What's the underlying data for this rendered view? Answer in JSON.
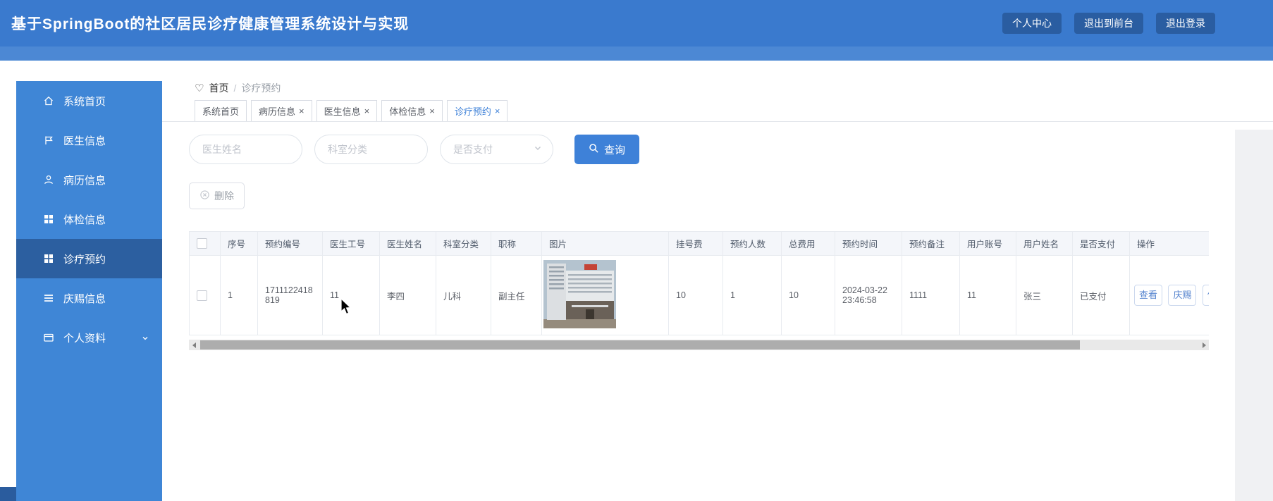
{
  "header": {
    "title": "基于SpringBoot的社区居民诊疗健康管理系统设计与实现",
    "actions": [
      {
        "label": "个人中心"
      },
      {
        "label": "退出到前台"
      },
      {
        "label": "退出登录"
      }
    ]
  },
  "sidebar": {
    "items": [
      {
        "label": "系统首页",
        "icon": "home-icon",
        "active": false
      },
      {
        "label": "医生信息",
        "icon": "flag-icon",
        "active": false
      },
      {
        "label": "病历信息",
        "icon": "user-icon",
        "active": false
      },
      {
        "label": "体检信息",
        "icon": "grid-icon",
        "active": false
      },
      {
        "label": "诊疗预约",
        "icon": "grid-icon",
        "active": true
      },
      {
        "label": "庆赐信息",
        "icon": "list-icon",
        "active": false
      },
      {
        "label": "个人资料",
        "icon": "folder-icon",
        "active": false,
        "has_submenu": true
      }
    ]
  },
  "breadcrumb": {
    "home": "首页",
    "current": "诊疗预约"
  },
  "tabs": [
    {
      "label": "系统首页",
      "closable": false,
      "active": false
    },
    {
      "label": "病历信息",
      "closable": true,
      "active": false
    },
    {
      "label": "医生信息",
      "closable": true,
      "active": false
    },
    {
      "label": "体检信息",
      "closable": true,
      "active": false
    },
    {
      "label": "诊疗预约",
      "closable": true,
      "active": true
    }
  ],
  "filters": {
    "doctor_name_placeholder": "医生姓名",
    "department_placeholder": "科室分类",
    "payment_placeholder": "是否支付",
    "search_label": "查询"
  },
  "toolbar": {
    "delete_label": "删除"
  },
  "table": {
    "columns": [
      "序号",
      "预约编号",
      "医生工号",
      "医生姓名",
      "科室分类",
      "职称",
      "图片",
      "挂号费",
      "预约人数",
      "总费用",
      "预约时间",
      "预约备注",
      "用户账号",
      "用户姓名",
      "是否支付",
      "操作"
    ],
    "rows": [
      {
        "seq": "1",
        "appointment_no": "1711122418819",
        "doctor_no": "11",
        "doctor_name": "李四",
        "department": "儿科",
        "job_title": "副主任",
        "image": "hospital-photo",
        "registration_fee": "10",
        "appointment_count": "1",
        "total_fee": "10",
        "appointment_time": "2024-03-22 23:46:58",
        "remark": "1111",
        "user_account": "11",
        "user_name": "张三",
        "payment_status": "已支付",
        "actions": {
          "view": "查看",
          "qingci": "庆赐",
          "edit": "修改"
        }
      }
    ]
  },
  "icons": {
    "heart": "♡",
    "close": "×",
    "breadcrumb_separator": "/"
  },
  "colors": {
    "header_bg": "#3a7ace",
    "subbar_bg": "#4c88d4",
    "sidebar_bg": "#3f86d6",
    "sidebar_active_bg": "#2c5fa0",
    "accent": "#3e81d8",
    "table_header_bg": "#f4f6fa"
  }
}
